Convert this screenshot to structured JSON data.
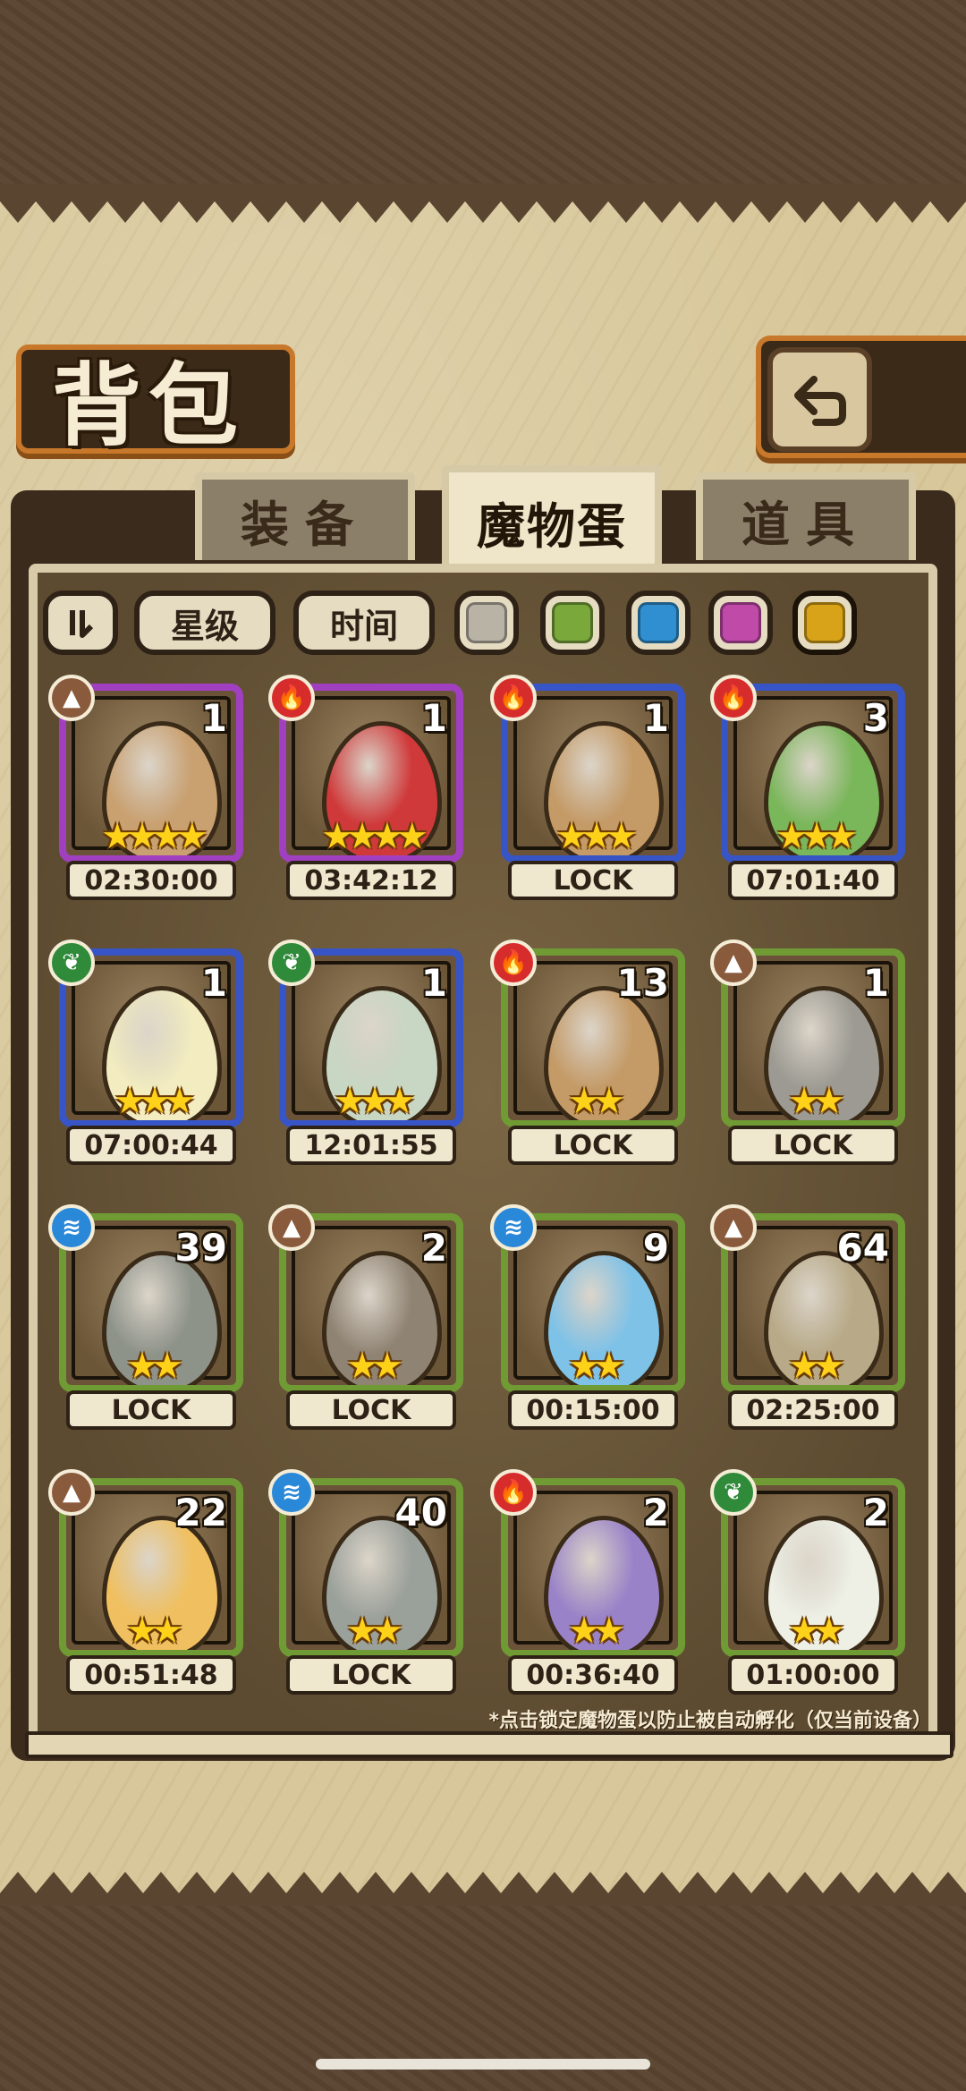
{
  "page": {
    "title": "背包"
  },
  "tabs": [
    {
      "label": "装备",
      "active": false
    },
    {
      "label": "魔物蛋",
      "active": true
    },
    {
      "label": "道具",
      "active": false
    }
  ],
  "sort": {
    "star_label": "星级",
    "time_label": "时间"
  },
  "filters": [
    {
      "name": "gray",
      "color": "#b9b3a6"
    },
    {
      "name": "green",
      "color": "#7aa83a"
    },
    {
      "name": "blue",
      "color": "#2f8fd0"
    },
    {
      "name": "purple",
      "color": "#c04aa8"
    },
    {
      "name": "gold",
      "color": "#d8a318",
      "selected": true
    }
  ],
  "colors": {
    "purple_frame": "#a040c0",
    "blue_frame": "#3855c8",
    "green_frame": "#6f9a34",
    "fire": "#d62c2c",
    "earth": "#8a5a3c",
    "leaf": "#2f8a3a",
    "water": "#2a88d8"
  },
  "eggs": [
    {
      "count": "1",
      "stars": "★★★★",
      "timer": "02:30:00",
      "element": "earth",
      "frame": "purple",
      "egg_color": "#c9a070"
    },
    {
      "count": "1",
      "stars": "★★★★",
      "timer": "03:42:12",
      "element": "fire",
      "frame": "purple",
      "egg_color": "#d0393a"
    },
    {
      "count": "1",
      "stars": "★★★",
      "timer": "LOCK",
      "element": "fire",
      "frame": "blue",
      "egg_color": "#c49a66"
    },
    {
      "count": "3",
      "stars": "★★★",
      "timer": "07:01:40",
      "element": "fire",
      "frame": "blue",
      "egg_color": "#7ab65a"
    },
    {
      "count": "1",
      "stars": "★★★",
      "timer": "07:00:44",
      "element": "leaf",
      "frame": "blue",
      "egg_color": "#f2ecc0"
    },
    {
      "count": "1",
      "stars": "★★★",
      "timer": "12:01:55",
      "element": "leaf",
      "frame": "blue",
      "egg_color": "#c8d7c4"
    },
    {
      "count": "13",
      "stars": "★★",
      "timer": "LOCK",
      "element": "fire",
      "frame": "green",
      "egg_color": "#c49a66"
    },
    {
      "count": "1",
      "stars": "★★",
      "timer": "LOCK",
      "element": "earth",
      "frame": "green",
      "egg_color": "#9c9a92"
    },
    {
      "count": "39",
      "stars": "★★",
      "timer": "LOCK",
      "element": "water",
      "frame": "green",
      "egg_color": "#8e938a"
    },
    {
      "count": "2",
      "stars": "★★",
      "timer": "LOCK",
      "element": "earth",
      "frame": "green",
      "egg_color": "#8f8373"
    },
    {
      "count": "9",
      "stars": "★★",
      "timer": "00:15:00",
      "element": "water",
      "frame": "green",
      "egg_color": "#7ec2e8"
    },
    {
      "count": "64",
      "stars": "★★",
      "timer": "02:25:00",
      "element": "earth",
      "frame": "green",
      "egg_color": "#b8aa88"
    },
    {
      "count": "22",
      "stars": "★★",
      "timer": "00:51:48",
      "element": "earth",
      "frame": "green",
      "egg_color": "#f0c060"
    },
    {
      "count": "40",
      "stars": "★★",
      "timer": "LOCK",
      "element": "water",
      "frame": "green",
      "egg_color": "#9aa09a"
    },
    {
      "count": "2",
      "stars": "★★",
      "timer": "00:36:40",
      "element": "fire",
      "frame": "green",
      "egg_color": "#9a82c8"
    },
    {
      "count": "2",
      "stars": "★★",
      "timer": "01:00:00",
      "element": "leaf",
      "frame": "green",
      "egg_color": "#eef0e6"
    }
  ],
  "hint": "*点击锁定魔物蛋以防止被自动孵化（仅当前设备）"
}
